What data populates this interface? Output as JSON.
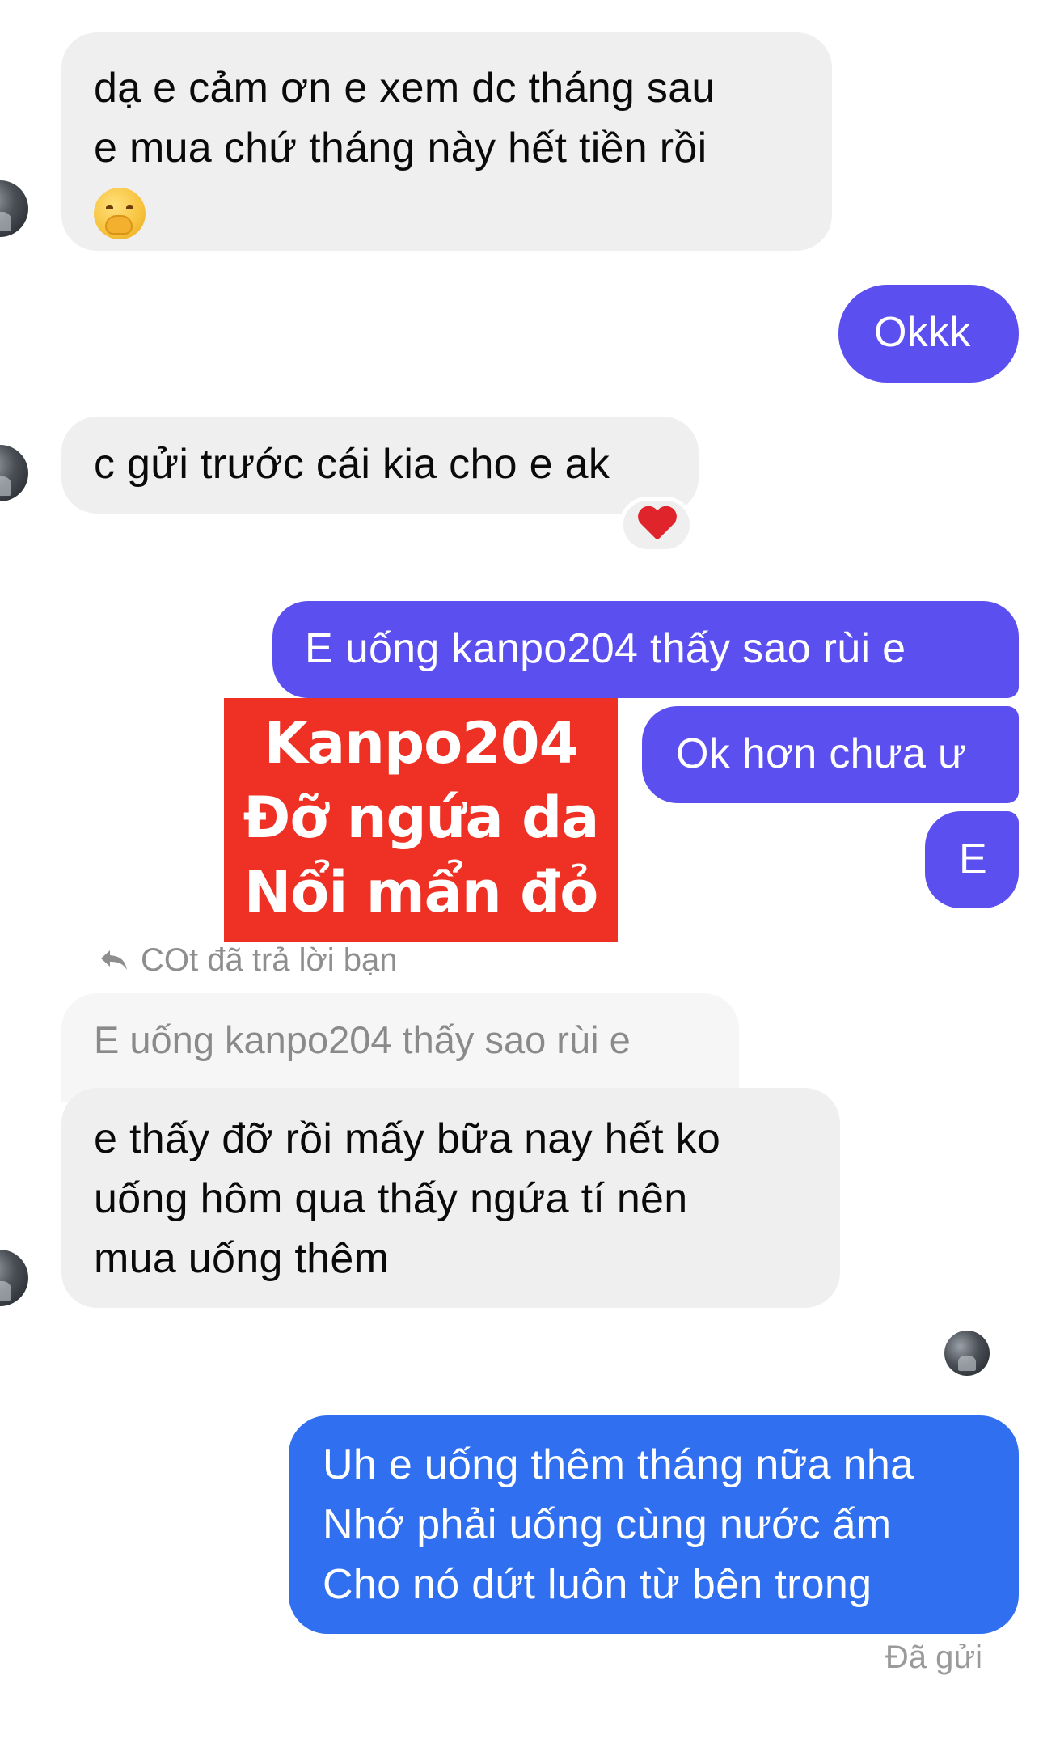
{
  "messages": {
    "m1": {
      "line1": "dạ e cảm ơn e xem dc tháng sau",
      "line2": "e mua chứ tháng này hết tiền rồi",
      "emoji": "face-with-hand-over-mouth"
    },
    "m2": {
      "text": "Okkk"
    },
    "m3": {
      "text": "c gửi trước cái kia cho e ak",
      "reaction": "red-heart"
    },
    "m4": {
      "text": "E uống kanpo204 thấy sao rùi e"
    },
    "m5": {
      "text": "Ok hơn chưa ư"
    },
    "m6": {
      "text": "E"
    },
    "m7": {
      "line1": "e thấy đỡ rồi mấy bữa nay hết ko",
      "line2": "uống hôm qua thấy ngứa tí nên",
      "line3": "mua uống thêm"
    },
    "m8": {
      "line1": "Uh e uống thêm tháng nữa nha",
      "line2": "Nhớ phải uống cùng nước ấm",
      "line3": "Cho nó dứt luôn từ bên trong"
    }
  },
  "banner": {
    "line1": "Kanpo204",
    "line2": "Đỡ ngứa da",
    "line3": "Nổi mẩn đỏ"
  },
  "reply": {
    "label": "COt đã trả lời bạn",
    "quoted_text": "E uống kanpo204 thấy sao rùi e"
  },
  "status": {
    "sent": "Đã gửi"
  },
  "colors": {
    "incoming_bubble": "#efefef",
    "outgoing_purple": "#5b4ff0",
    "outgoing_blue": "#2f6ff0",
    "banner_red": "#ee3124",
    "heart_red": "#e0242c"
  }
}
